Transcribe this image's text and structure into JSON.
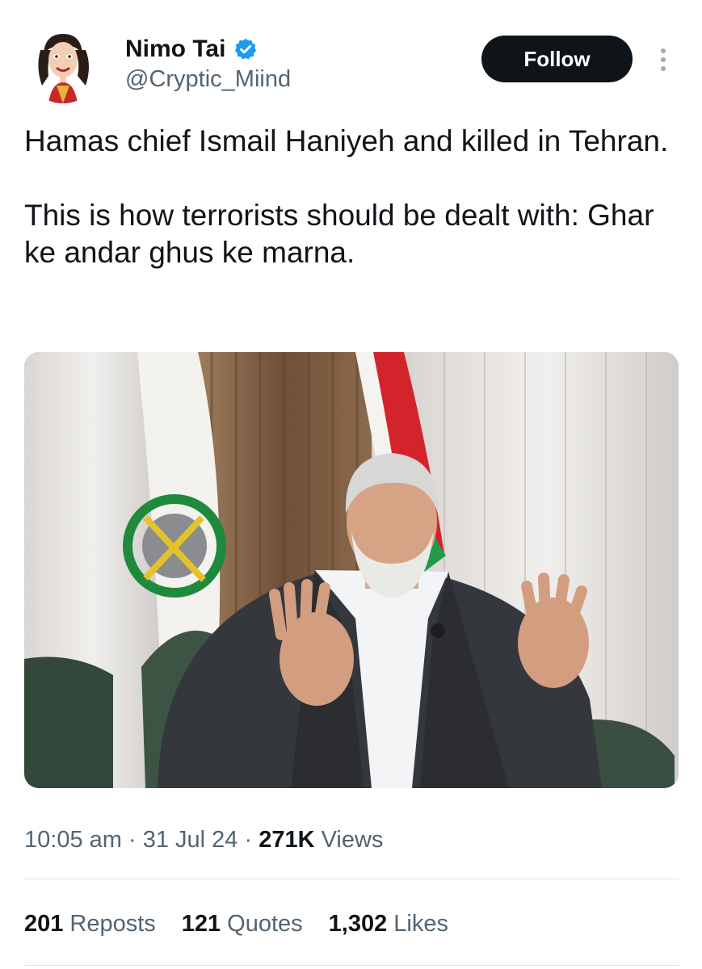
{
  "author": {
    "display_name": "Nimo Tai",
    "handle": "@Cryptic_Miind",
    "verified": true,
    "avatar_icon": "caricature-avatar"
  },
  "actions": {
    "follow_label": "Follow",
    "more_icon": "more-vertical-icon"
  },
  "tweet": {
    "paragraphs": [
      "Hamas chief Ismail Haniyeh and killed in Tehran.",
      "This is how terrorists should be dealt with: Ghar ke andar ghus ke marna."
    ]
  },
  "meta": {
    "time": "10:05 am",
    "separator": " · ",
    "date": "31 Jul 24",
    "views_count": "271K",
    "views_label": "Views"
  },
  "stats": {
    "reposts_count": "201",
    "reposts_label": "Reposts",
    "quotes_count": "121",
    "quotes_label": "Quotes",
    "likes_count": "1,302",
    "likes_label": "Likes"
  },
  "colors": {
    "text": "#0f1419",
    "secondary": "#536471",
    "verified_blue": "#1d9bf0",
    "follow_bg": "#0f1419",
    "divider": "#dfe3e6"
  }
}
